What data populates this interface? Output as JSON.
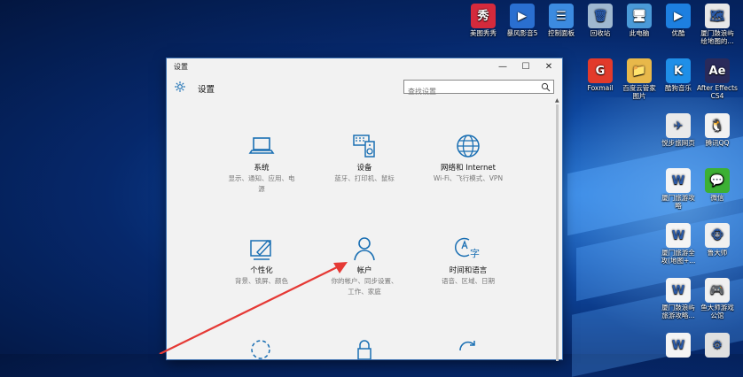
{
  "desktop_top_icons": [
    {
      "label": "美图秀秀",
      "color": "#d42a3c",
      "glyph": "秀"
    },
    {
      "label": "暴风影音5",
      "color": "#2a6fd0",
      "glyph": "▶"
    },
    {
      "label": "控制面板",
      "color": "#3c8be0",
      "glyph": "☰"
    },
    {
      "label": "回收站",
      "color": "#9fb8d0",
      "glyph": "🗑"
    },
    {
      "label": "此电脑",
      "color": "#4a9ad8",
      "glyph": "🖥"
    },
    {
      "label": "优酷",
      "color": "#1d7fe0",
      "glyph": "▶"
    },
    {
      "label": "厦门鼓浪屿\n绘地图的...",
      "color": "#e8e8e8",
      "glyph": "🗺"
    }
  ],
  "desktop_right_icons": [
    {
      "label": "Foxmail",
      "color": "#e23a2b",
      "glyph": "G"
    },
    {
      "label": "百度云管家\n图片",
      "color": "#e8b84a",
      "glyph": "📁"
    },
    {
      "label": "酷狗音乐",
      "color": "#1f8fe8",
      "glyph": "K"
    },
    {
      "label": "After Effects\nCS4",
      "color": "#2a2a5a",
      "glyph": "Ae"
    },
    {
      "label": "悦步旅网页",
      "color": "#eaeaea",
      "glyph": "✈"
    },
    {
      "label": "腾讯QQ",
      "color": "#f2f2f2",
      "glyph": "🐧"
    },
    {
      "label": "厦门旅游攻\n略",
      "color": "#f4f4f4",
      "glyph": "W"
    },
    {
      "label": "微信",
      "color": "#3cb034",
      "glyph": "💬"
    },
    {
      "label": "厦门旅游全\n攻(地图+...",
      "color": "#f4f4f4",
      "glyph": "W"
    },
    {
      "label": "鲁大师",
      "color": "#f0f0f0",
      "glyph": "🐵"
    },
    {
      "label": "厦门鼓浪屿\n旅游攻略...",
      "color": "#f4f4f4",
      "glyph": "W"
    },
    {
      "label": "鱼大师游戏\n公馆",
      "color": "#f0f0f0",
      "glyph": "🎮"
    },
    {
      "label": "",
      "color": "#f4f4f4",
      "glyph": "W"
    },
    {
      "label": "",
      "color": "#e0e0e0",
      "glyph": "⚙"
    }
  ],
  "window": {
    "title": "设置",
    "header": "设置",
    "search_placeholder": "查找设置",
    "minimize": "—",
    "maximize": "☐",
    "close": "✕"
  },
  "tiles": [
    {
      "name": "系统",
      "desc": [
        "显示、通知、应用、电",
        "源"
      ]
    },
    {
      "name": "设备",
      "desc": [
        "蓝牙、打印机、鼠标"
      ]
    },
    {
      "name": "网络和 Internet",
      "desc": [
        "Wi-Fi、飞行模式、VPN"
      ]
    },
    {
      "name": "个性化",
      "desc": [
        "背景、锁屏、颜色"
      ]
    },
    {
      "name": "帐户",
      "desc": [
        "你的帐户、同步设置、",
        "工作、家庭"
      ]
    },
    {
      "name": "时间和语言",
      "desc": [
        "语音、区域、日期"
      ]
    }
  ],
  "colors": {
    "accent": "#1a6fb3",
    "arrow": "#e53935"
  }
}
